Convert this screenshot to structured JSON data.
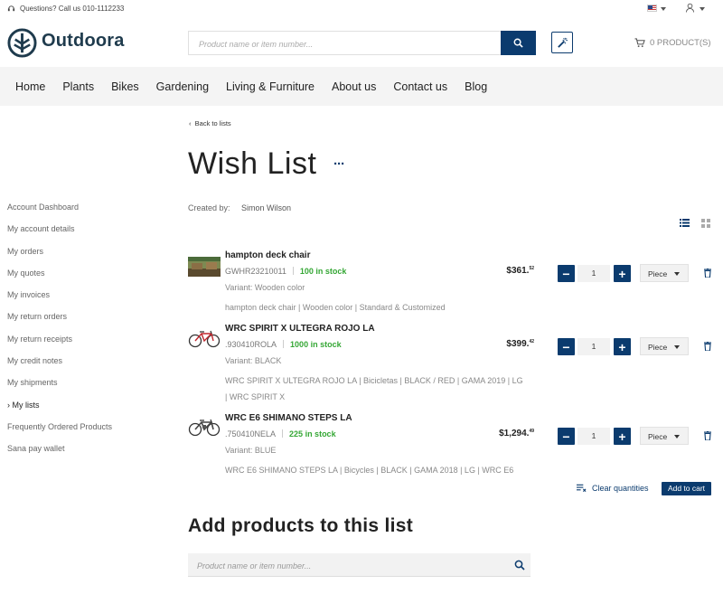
{
  "topbar": {
    "contact_text": "Questions? Call us 010-1112233"
  },
  "header": {
    "brand": "Outdoora",
    "search_placeholder": "Product name or item number...",
    "cart_label": "0 PRODUCT(S)"
  },
  "nav": [
    "Home",
    "Plants",
    "Bikes",
    "Gardening",
    "Living & Furniture",
    "About us",
    "Contact us",
    "Blog"
  ],
  "sidebar": [
    "Account Dashboard",
    "My account details",
    "My orders",
    "My quotes",
    "My invoices",
    "My return orders",
    "My return receipts",
    "My credit notes",
    "My shipments",
    "› My lists",
    "Frequently Ordered Products",
    "Sana pay wallet"
  ],
  "list": {
    "back_label": "Back to lists",
    "title": "Wish List",
    "more": "···",
    "created_by_label": "Created by:",
    "created_by_value": "Simon Wilson"
  },
  "products": [
    {
      "name": "hampton deck chair",
      "sku": "GWHR23210011",
      "stock": "100 in stock",
      "variant": "Variant: Wooden color",
      "desc": "hampton deck chair | Wooden color | Standard & Customized",
      "price_main": "$361.",
      "price_cents": "52",
      "qty": "1",
      "unit": "Piece"
    },
    {
      "name": "WRC SPIRIT X ULTEGRA ROJO LA",
      "sku": ".930410ROLA",
      "stock": "1000 in stock",
      "variant": "Variant: BLACK",
      "desc": "WRC SPIRIT X ULTEGRA ROJO LA | Bicicletas | BLACK / RED | GAMA 2019 | LG | WRC SPIRIT X",
      "price_main": "$399.",
      "price_cents": "42",
      "qty": "1",
      "unit": "Piece"
    },
    {
      "name": "WRC E6 SHIMANO STEPS LA",
      "sku": ".750410NELA",
      "stock": "225 in stock",
      "variant": "Variant: BLUE",
      "desc": "WRC E6 SHIMANO STEPS LA | Bicycles | BLACK | GAMA 2018 | LG | WRC E6",
      "price_main": "$1,294.",
      "price_cents": "49",
      "qty": "1",
      "unit": "Piece"
    }
  ],
  "actions": {
    "clear_label": "Clear quantities",
    "add_to_cart_label": "Add to cart",
    "minus": "−",
    "plus": "+"
  },
  "add_products": {
    "title": "Add products to this list",
    "placeholder": "Product name or item number..."
  },
  "colors": {
    "primary": "#0b3b6e",
    "stock": "#35a735",
    "nav_bg": "#f4f4f4"
  }
}
